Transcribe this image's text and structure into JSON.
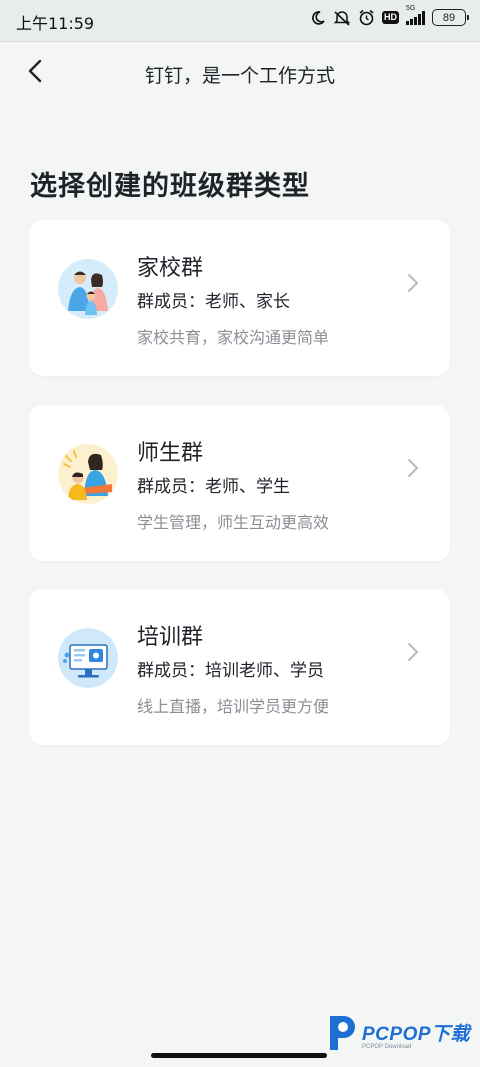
{
  "status_bar": {
    "time": "上午11:59",
    "network": "5G",
    "hd": "HD",
    "battery": "89"
  },
  "header": {
    "title": "钉钉，是一个工作方式"
  },
  "section_title": "选择创建的班级群类型",
  "cards": [
    {
      "title": "家校群",
      "members": "群成员：老师、家长",
      "description": "家校共育，家校沟通更简单",
      "icon": "family-illustration"
    },
    {
      "title": "师生群",
      "members": "群成员：老师、学生",
      "description": "学生管理，师生互动更高效",
      "icon": "teacher-student-illustration"
    },
    {
      "title": "培训群",
      "members": "群成员：培训老师、学员",
      "description": "线上直播，培训学员更方便",
      "icon": "training-screen-illustration"
    }
  ],
  "watermark": {
    "main": "PCPOP下载",
    "sub": "PCPOP Download"
  },
  "colors": {
    "background": "#f3f6f5",
    "card": "#ffffff",
    "accent": "#1d6fd4",
    "secondary_text": "#8a8f95"
  }
}
